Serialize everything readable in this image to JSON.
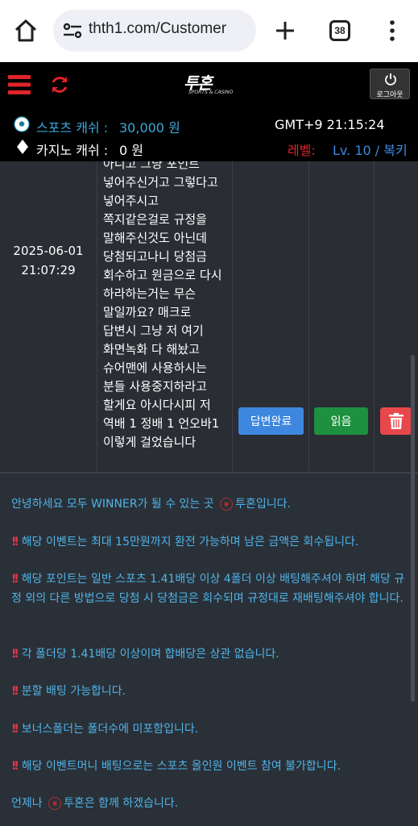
{
  "browser": {
    "url": "thth1.com/Customer",
    "tab_count": "38"
  },
  "header": {
    "logo_text": "투혼",
    "logo_sub": "SPORTS & CASINO",
    "logout_label": "로그아웃"
  },
  "balance": {
    "sports_label": "스포츠 캐쉬 :",
    "sports_value": "30,000 원",
    "casino_label": "카지노 캐쉬 :",
    "casino_value": "0 원",
    "clock": "GMT+9 21:15:24",
    "level_label": "레벨:",
    "level_value": "Lv. 10 / 복키"
  },
  "row": {
    "date": "2025-06-01\n21:07:29",
    "content": "아니고 그냥 포인트\n넣어주신거고 그렇다고\n넣어주시고\n쪽지같은걸로 규정을\n말해주신것도 아닌데\n당첨되고나니 당첨금\n회수하고 원금으로 다시\n하라하는거는 무슨\n말일까요? 매크로\n답변시 그냥 저 여기\n화면녹화 다 해놨고\n슈어맨에 사용하시는\n분들 사용중지하라고\n할게요 아시다시피 저\n역배 1 정배 1 언오바1\n이렇게 걸었습니다",
    "status_label": "답변완료",
    "read_label": "읽음"
  },
  "notice": {
    "line1_a": "안녕하세요 모두 WINNER가 될 수 있는 곳",
    "line1_b": "투혼입니다.",
    "line2": "해당 이벤트는 최대 15만원까지 환전 가능하며 남은 금액은 회수됩니다.",
    "line3": "해당 포인트는 일반 스포츠 1.41배당 이상 4폴더 이상 배팅해주셔야 하며 해당 규정 외의 다른 방법으로 당첨 시 당첨금은 회수되며 규정대로 재배팅해주셔야 합니다.",
    "line4": "각 폴더당 1.41배당 이상이며 합배당은 상관 없습니다.",
    "line5": "분할 배팅 가능합니다.",
    "line6": "보너스폴더는 폴더수에 미포함입니다.",
    "line7": "해당 이벤트머니 배팅으로는 스포츠 올인원 이벤트 참여 불가합니다.",
    "line8_a": "언제나",
    "line8_b": "투혼은 함께 하겠습니다."
  },
  "colors": {
    "accent_blue": "#3d87df",
    "read_green": "#1d9140",
    "delete_red": "#e8484b",
    "notice_text": "#4fb4e8",
    "level_red": "#e0242a"
  }
}
